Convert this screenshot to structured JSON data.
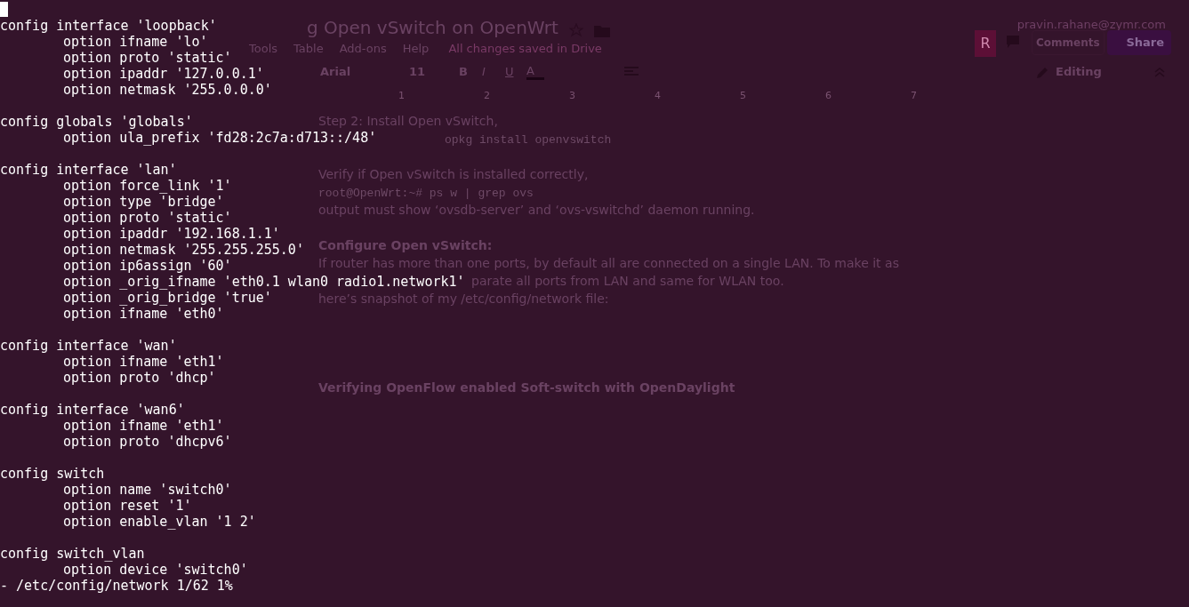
{
  "document": {
    "title": "g Open vSwitch on OpenWrt",
    "account": "pravin.rahane@zymr.com",
    "avatar": "R",
    "comments": "Comments",
    "share": "Share",
    "menu": [
      "Tools",
      "Table",
      "Add-ons",
      "Help"
    ],
    "save_status": "All changes saved in Drive",
    "toolbar": {
      "font": "Arial",
      "size": "11",
      "bold": "B",
      "italic": "I",
      "underline": "U",
      "text_color_label": "A",
      "mode": "Editing"
    },
    "ruler": [
      "1",
      "2",
      "3",
      "4",
      "5",
      "6",
      "7"
    ],
    "body": [
      {
        "kind": "text",
        "text": "Step 2: Install Open vSwitch,"
      },
      {
        "kind": "codepart",
        "text": "opkg install openvswitch"
      },
      {
        "kind": "blank"
      },
      {
        "kind": "text",
        "text": "Verify if Open vSwitch is installed correctly,"
      },
      {
        "kind": "code",
        "text": "root@OpenWrt:~# ps w | grep ovs"
      },
      {
        "kind": "text",
        "text": "output must show ‘ovsdb-server’ and ‘ovs-vswitchd’ daemon running."
      },
      {
        "kind": "blank"
      },
      {
        "kind": "heading",
        "text": "Configure Open vSwitch:"
      },
      {
        "kind": "text",
        "text": "If router has more than one ports, by default all are connected on a single LAN. To make it as"
      },
      {
        "kind": "partial",
        "text": "parate all ports from LAN and same for WLAN too."
      },
      {
        "kind": "text",
        "text": "here’s snapshot of my /etc/config/network file:"
      },
      {
        "kind": "blank"
      },
      {
        "kind": "blank"
      },
      {
        "kind": "blank"
      },
      {
        "kind": "blank"
      },
      {
        "kind": "heading",
        "text": "Verifying OpenFlow enabled Soft-switch with OpenDaylight"
      }
    ]
  },
  "terminal": {
    "blocks": [
      {
        "header": "config interface 'loopback'",
        "options": [
          "option ifname 'lo'",
          "option proto 'static'",
          "option ipaddr '127.0.0.1'",
          "option netmask '255.0.0.0'"
        ]
      },
      {
        "header": "config globals 'globals'",
        "options": [
          "option ula_prefix 'fd28:2c7a:d713::/48'"
        ]
      },
      {
        "header": "config interface 'lan'",
        "options": [
          "option force_link '1'",
          "option type 'bridge'",
          "option proto 'static'",
          "option ipaddr '192.168.1.1'",
          "option netmask '255.255.255.0'",
          "option ip6assign '60'",
          "option _orig_ifname 'eth0.1 wlan0 radio1.network1'",
          "option _orig_bridge 'true'",
          "option ifname 'eth0'"
        ]
      },
      {
        "header": "config interface 'wan'",
        "options": [
          "option ifname 'eth1'",
          "option proto 'dhcp'"
        ]
      },
      {
        "header": "config interface 'wan6'",
        "options": [
          "option ifname 'eth1'",
          "option proto 'dhcpv6'"
        ]
      },
      {
        "header": "config switch",
        "options": [
          "option name 'switch0'",
          "option reset '1'",
          "option enable_vlan '1 2'"
        ]
      },
      {
        "header": "config switch_vlan",
        "options": [
          "option device 'switch0'"
        ]
      }
    ],
    "status": "- /etc/config/network 1/62 1%"
  }
}
